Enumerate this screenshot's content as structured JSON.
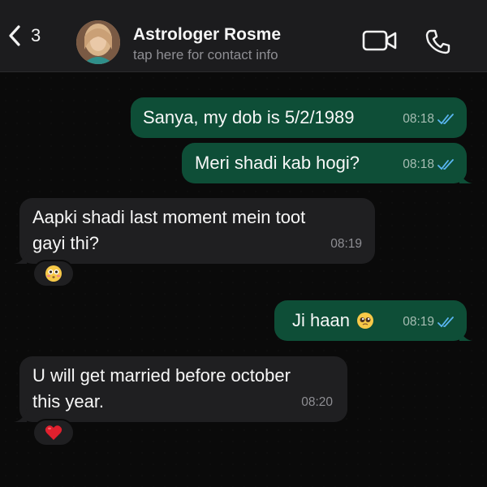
{
  "header": {
    "back_count": "3",
    "contact_name": "Astrologer Rosme",
    "subtitle": "tap here for contact info"
  },
  "messages": [
    {
      "direction": "outgoing",
      "text": "Sanya, my dob is 5/2/1989",
      "time": "08:18",
      "status": "read"
    },
    {
      "direction": "outgoing",
      "text": "Meri shadi kab hogi?",
      "time": "08:18",
      "status": "read"
    },
    {
      "direction": "incoming",
      "text_line1": "Aapki shadi last moment mein toot",
      "text_line2": "gayi thi?",
      "time": "08:19",
      "reaction": "flushed-face-emoji"
    },
    {
      "direction": "outgoing",
      "text": "Ji haan",
      "emoji": "pleading-face-emoji",
      "time": "08:19",
      "status": "read"
    },
    {
      "direction": "incoming",
      "text_line1": "U will get married before october",
      "text_line2": "this year.",
      "time": "08:20",
      "reaction": "red-heart-emoji"
    }
  ],
  "colors": {
    "outgoing_bubble": "#0e4e37",
    "incoming_bubble": "#1f1f21",
    "read_tick": "#5ab6f2",
    "header_bg": "#1c1c1e"
  }
}
